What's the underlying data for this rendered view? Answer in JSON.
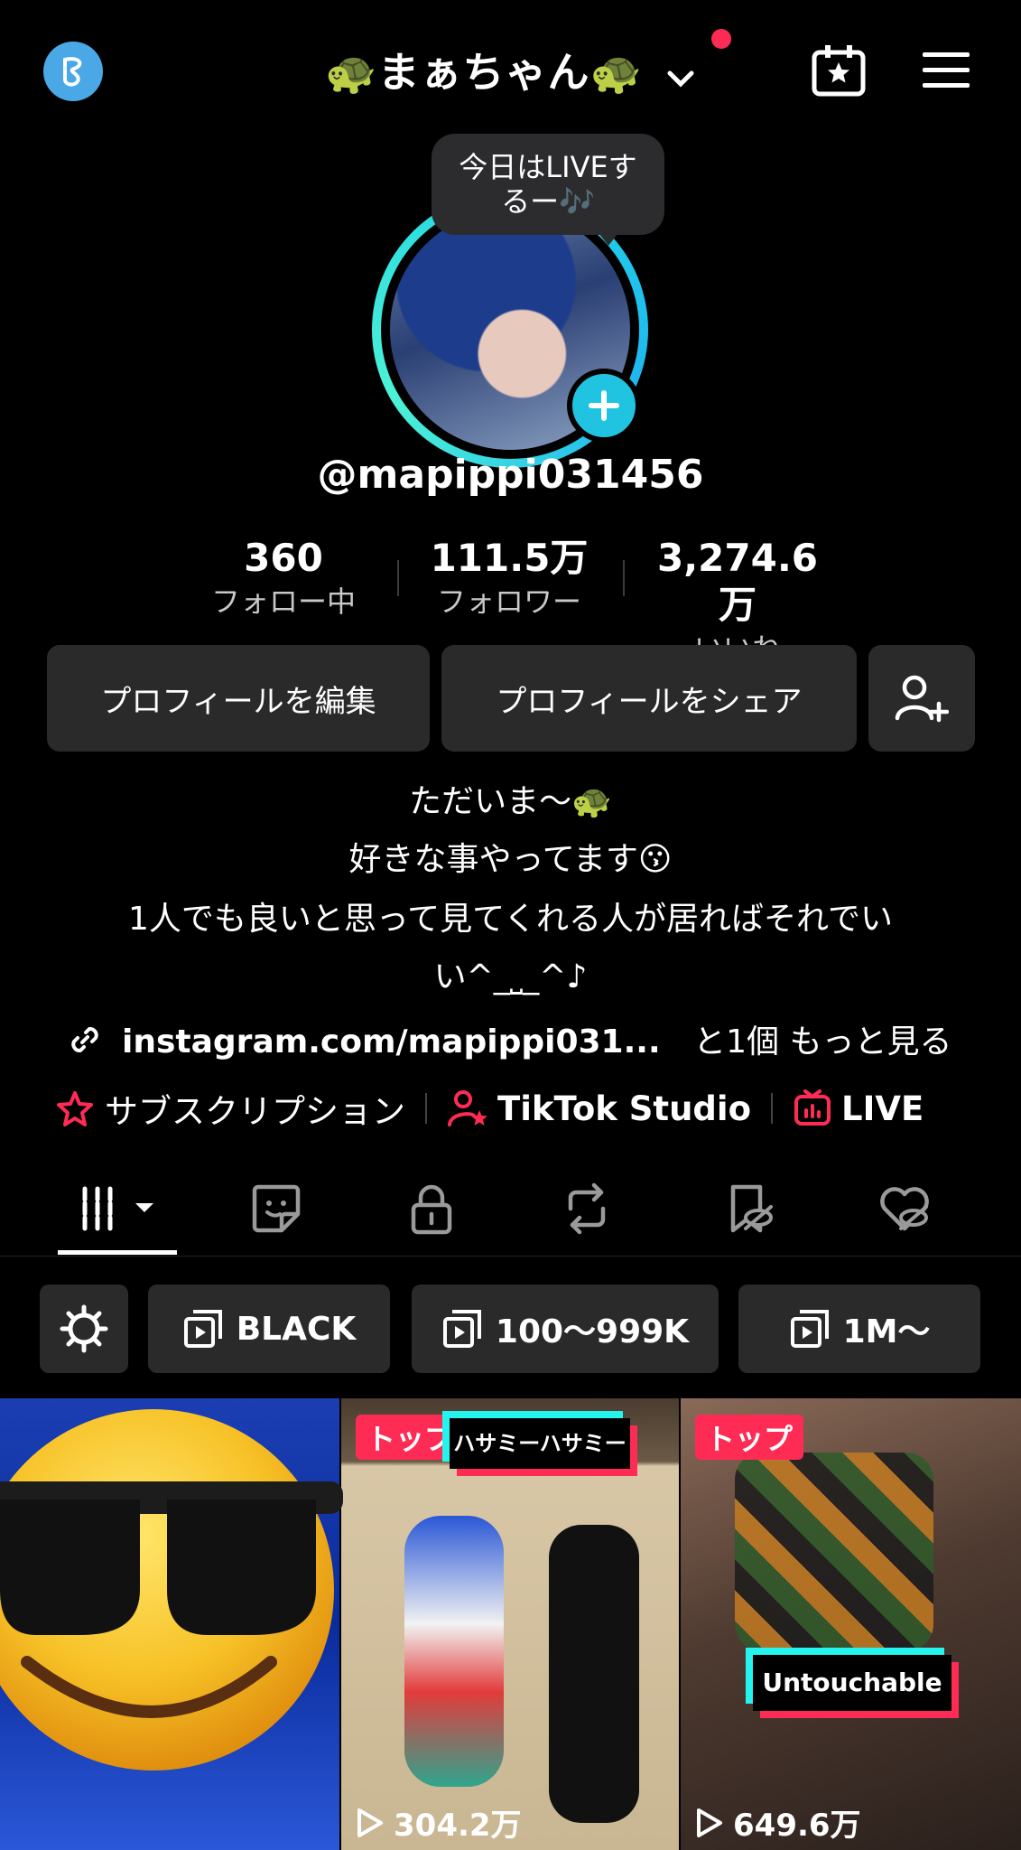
{
  "header": {
    "username": "🐢まぁちゃん🐢",
    "icons": [
      "app-logo-icon",
      "chevron-down-icon",
      "calendar-star-icon",
      "menu-icon"
    ],
    "notification_color": "#fe2c55"
  },
  "profile": {
    "bubble_line1": "今日はLIVEす",
    "bubble_line2": "るー🎶",
    "handle": "@mapippi031456",
    "accent": "#20c4e0"
  },
  "stats": [
    {
      "value": "360",
      "label": "フォロー中"
    },
    {
      "value": "111.5万",
      "label": "フォロワー"
    },
    {
      "value": "3,274.6万",
      "label": "いいね"
    }
  ],
  "actions": {
    "edit_label": "プロフィールを編集",
    "share_label": "プロフィールをシェア"
  },
  "bio": {
    "line1": "ただいま〜🐢",
    "line2": "好きな事やってます😗",
    "line3": "1人でも良いと思って見てくれる人が居ればそれでい",
    "line4": "い^_⎵_^♪",
    "link": "instagram.com/mapippi031...",
    "link_more": "と1個 もっと見る"
  },
  "features": {
    "subscription": "サブスクリプション",
    "studio": "TikTok Studio",
    "live": "LIVE"
  },
  "tabs": [
    "videos",
    "stickers",
    "private",
    "reposts",
    "favorites-hidden",
    "liked-hidden"
  ],
  "chips": {
    "c1": "BLACK",
    "c2": "100〜999K",
    "c3": "1M〜"
  },
  "videos": [
    {
      "badge": "",
      "caption": "",
      "views": ""
    },
    {
      "badge": "トップ",
      "caption": "ハサミーハサミー",
      "views": "304.2万"
    },
    {
      "badge": "トップ",
      "caption": "Untouchable",
      "views": "649.6万"
    }
  ]
}
